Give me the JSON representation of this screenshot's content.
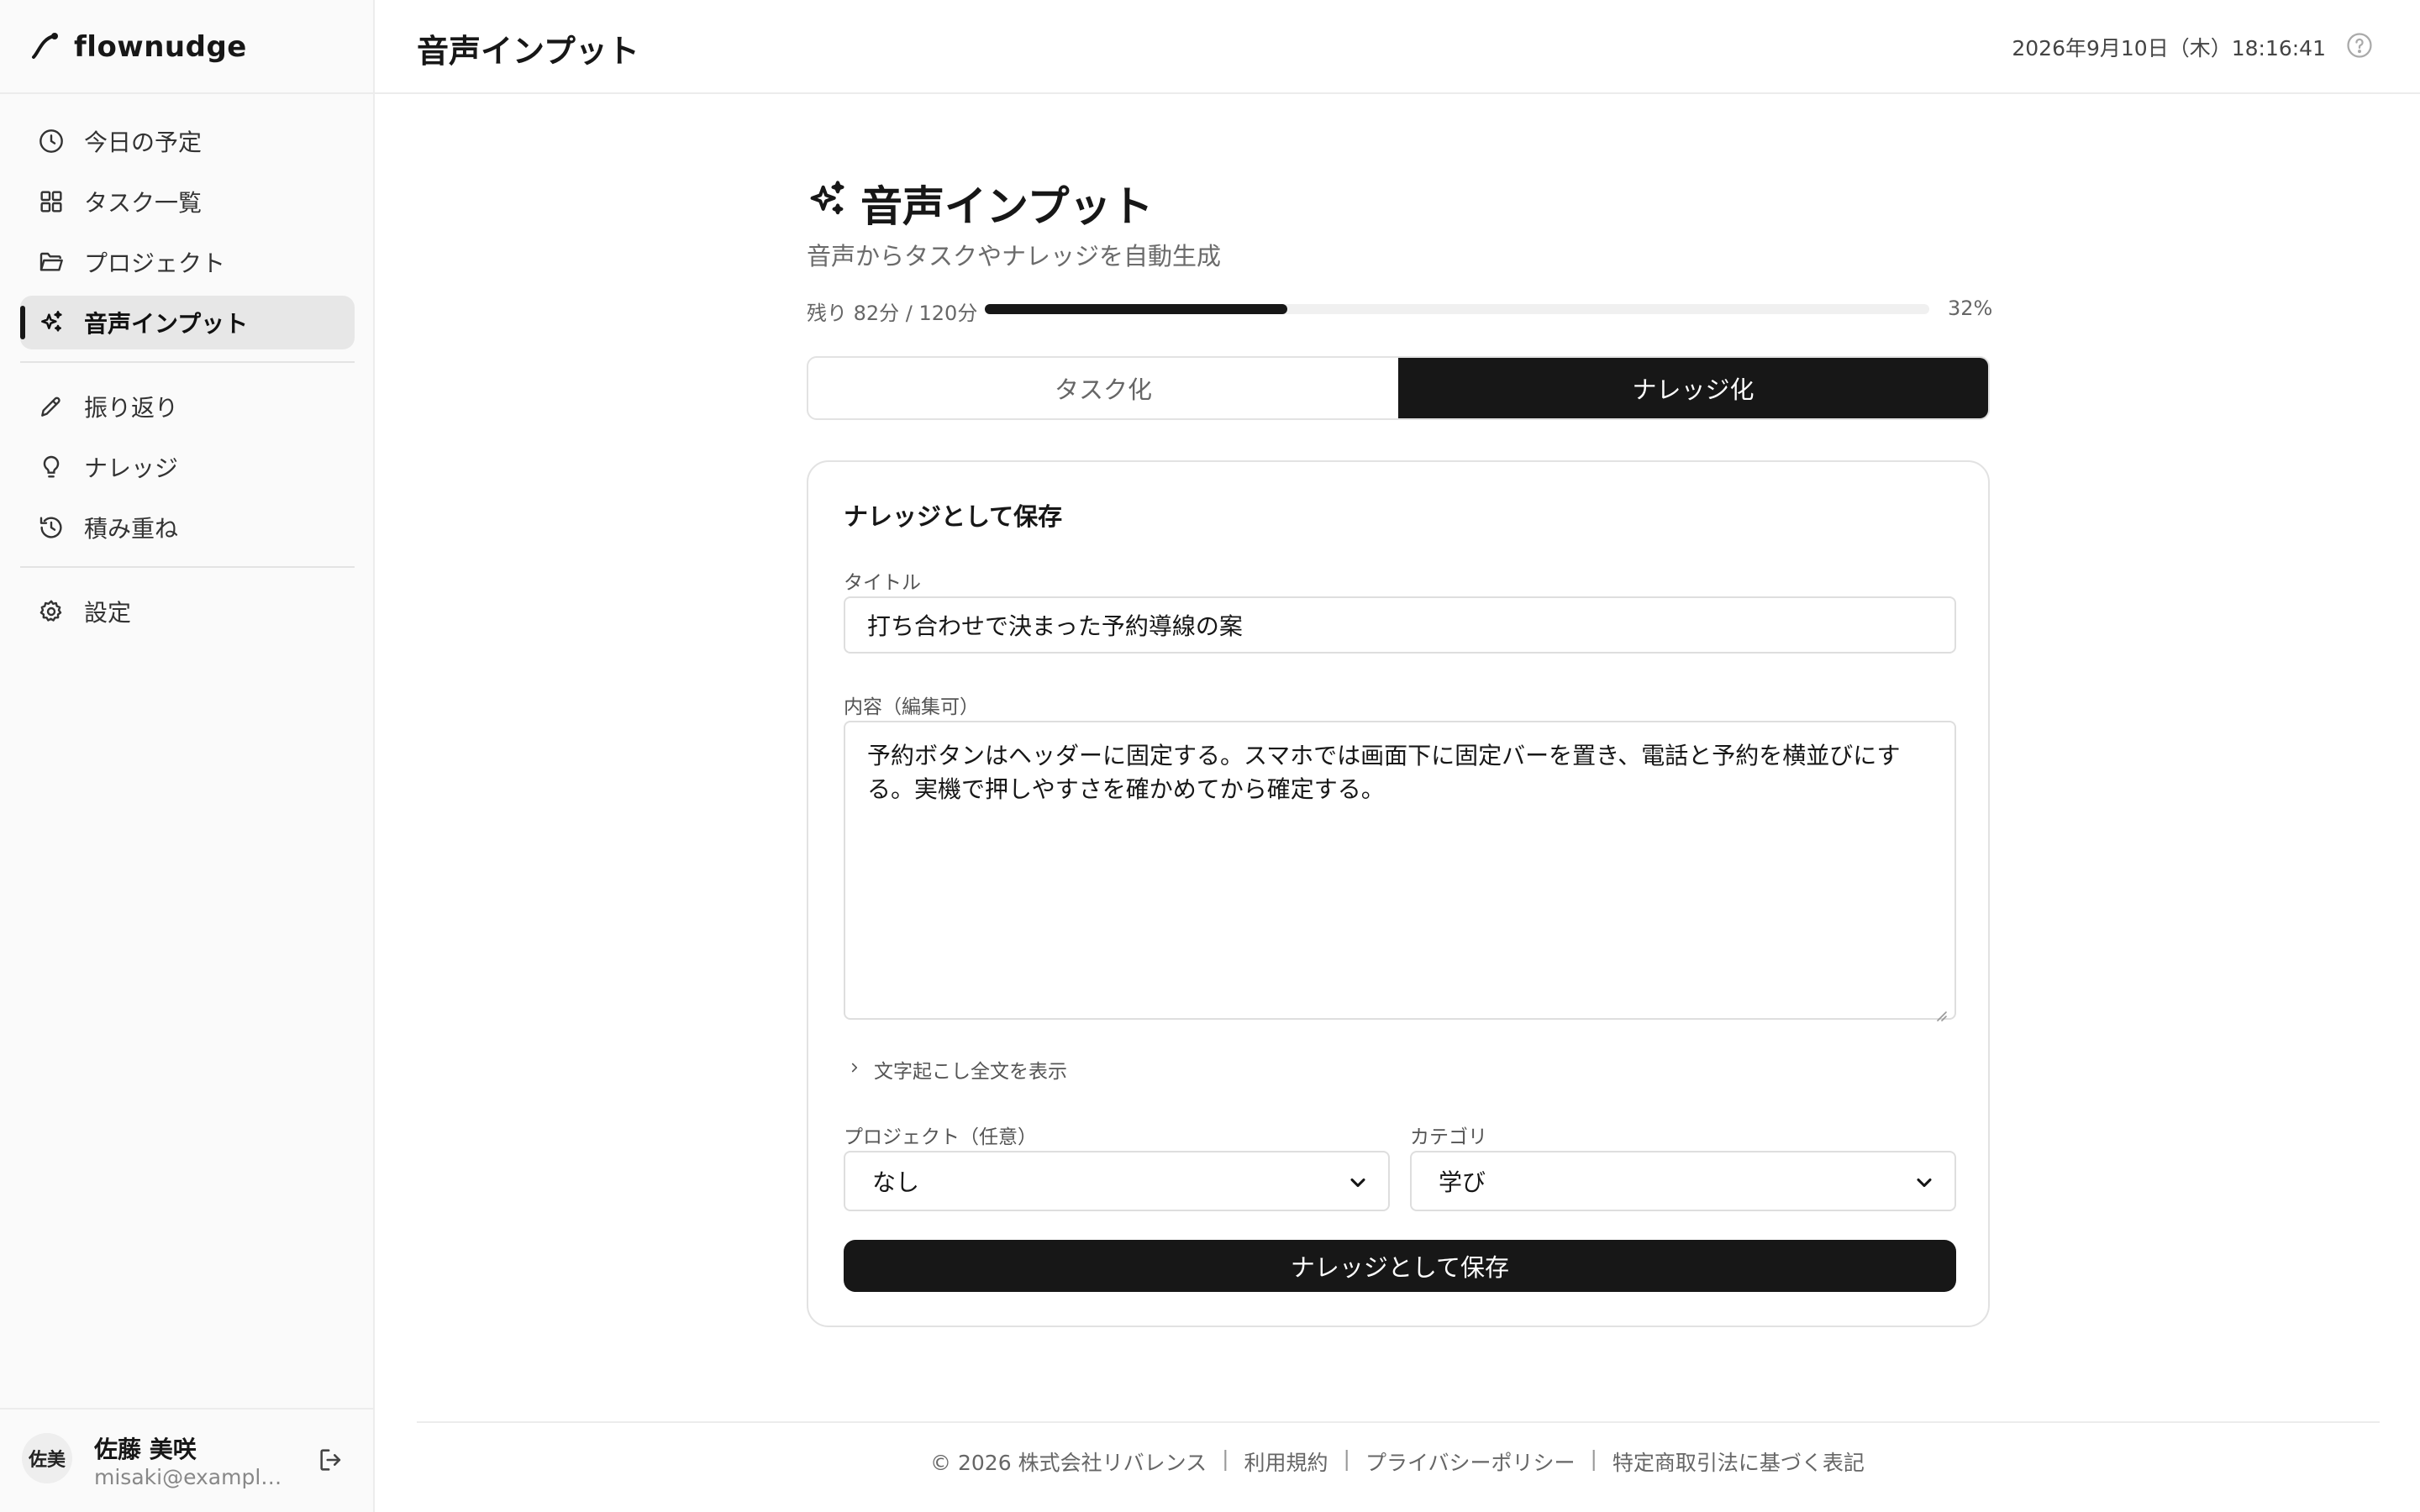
{
  "app": {
    "brand": "flownudge"
  },
  "sidebar": {
    "items": [
      {
        "label": "今日の予定",
        "icon": "clock-icon"
      },
      {
        "label": "タスク一覧",
        "icon": "grid-icon"
      },
      {
        "label": "プロジェクト",
        "icon": "folder-icon"
      },
      {
        "label": "音声インプット",
        "icon": "sparkles-icon",
        "active": true
      },
      {
        "label": "振り返り",
        "icon": "pencil-icon"
      },
      {
        "label": "ナレッジ",
        "icon": "lightbulb-icon"
      },
      {
        "label": "積み重ね",
        "icon": "history-icon"
      },
      {
        "label": "設定",
        "icon": "gear-icon"
      }
    ]
  },
  "user": {
    "avatar": "佐美",
    "name": "佐藤 美咲",
    "email": "misaki@example.com"
  },
  "header": {
    "title": "音声インプット",
    "datetime": "2026年9月10日（木）18:16:41"
  },
  "main": {
    "title": "音声インプット",
    "subtitle": "音声からタスクやナレッジを自動生成",
    "usage": {
      "label": "残り 82分 / 120分",
      "percent_label": "32%",
      "fraction": 0.32
    },
    "tabs": [
      {
        "label": "タスク化",
        "active": false
      },
      {
        "label": "ナレッジ化",
        "active": true
      }
    ],
    "form": {
      "heading": "ナレッジとして保存",
      "title_label": "タイトル",
      "title_value": "打ち合わせで決まった予約導線の案",
      "content_label": "内容（編集可）",
      "content_value": "予約ボタンはヘッダーに固定する。スマホでは画面下に固定バーを置き、電話と予約を横並びにする。実機で押しやすさを確かめてから確定する。",
      "transcript_toggle": "文字起こし全文を表示",
      "project_label": "プロジェクト（任意）",
      "project_value": "なし",
      "category_label": "カテゴリ",
      "category_value": "学び",
      "save_label": "ナレッジとして保存"
    }
  },
  "footer": {
    "copyright": "© 2026 株式会社リバレンス",
    "links": [
      "利用規約",
      "プライバシーポリシー",
      "特定商取引法に基づく表記"
    ],
    "separator": "|"
  },
  "colors": {
    "accent": "#171717",
    "border": "#e2e2e2",
    "sidebar_bg": "#fafafa"
  }
}
